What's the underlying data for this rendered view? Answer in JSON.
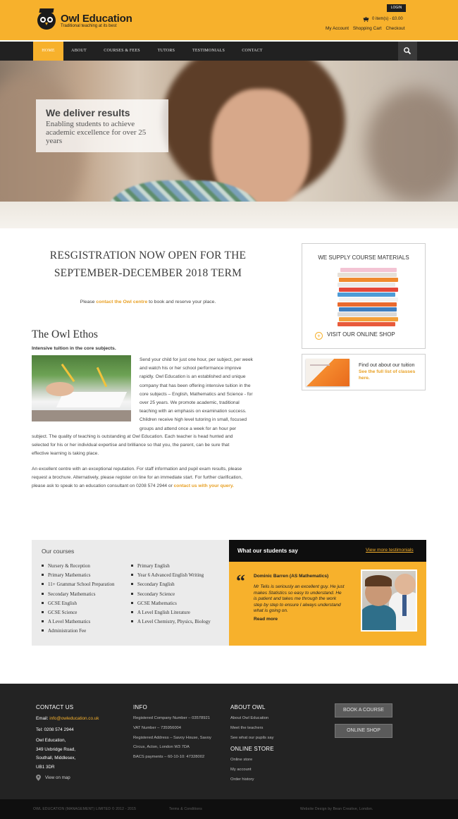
{
  "header": {
    "brand_name": "Owl Education",
    "brand_tagline": "Traditional teaching at its best",
    "login_label": "LOGIN",
    "cart_summary": "0 item(s) - £0.00",
    "account_links": [
      "My Account",
      "Shopping Cart",
      "Checkout"
    ],
    "colors": {
      "accent": "#f7b12c",
      "nav_bg": "#212121"
    }
  },
  "nav": {
    "items": [
      "HOME",
      "ABOUT",
      "COURSES & FEES",
      "TUTORS",
      "TESTIMONIALS",
      "CONTACT"
    ],
    "active": "HOME",
    "search_icon": "search-icon"
  },
  "hero": {
    "title": "We deliver results",
    "subtitle": "Enabling students to achieve academic excellence for over 25 years"
  },
  "registration": {
    "title_line1": "RESGISTRATION NOW OPEN FOR THE",
    "title_line2": "SEPTEMBER-DECEMBER 2018 TERM",
    "note_before": "Please ",
    "note_link": "contact the Owl centre",
    "note_after": " to book and reserve your place."
  },
  "ethos": {
    "title": "The Owl Ethos",
    "subtitle": "Intensive tuition in the core subjects.",
    "para1_lines": [
      "Send your child for just one hour, per subject, per week",
      "and watch his or her school performance improve",
      "rapidly. Owl Education is an established and unique",
      "company that has been offering intensive tuition in the",
      "core subjects – English, Mathematics and Science - for",
      "over 25 years. We promote academic, traditional",
      "teaching with an emphasis on examination success.",
      "Children receive high level tutoring in small, focused",
      "groups and attend once a week for an hour per"
    ],
    "para1_tail_lines": [
      "subject. The quality of teaching is outstanding at Owl Education. Each teacher is head hunted and",
      "selected for his or her individual expertise and brilliance so that you, the parent, can be sure that",
      "effective learning is taking place."
    ],
    "para2_lines": [
      "An excellent centre with an exceptional reputation. For staff information and pupil exam results, please",
      "request a brochure. Alternatively, please register on line for an immediate start. For further clarification,"
    ],
    "para2_last": "please ask to speak to an education consultant on 0208 574 2944 or ",
    "para2_link": "contact us with your query."
  },
  "sidebar": {
    "supply_title": "WE SUPPLY COURSE MATERIALS",
    "visit_label": "VISIT OUR ONLINE SHOP",
    "tuition_title": "Find out about our tuition",
    "tuition_link": "See the full list of classes here."
  },
  "courses": {
    "title": "Our courses",
    "column1": [
      "Nursery & Reception",
      "Primary Mathematics",
      "11+ Grammar School Preparation",
      "Secondary Mathematics",
      "GCSE English",
      "GCSE Science",
      "A Level Mathematics",
      "Administration Fee"
    ],
    "column2": [
      "Primary English",
      "Year 6 Advanced English Writing",
      "Secondary English",
      "Secondary Science",
      "GCSE Mathematics",
      "A Level English Literature",
      "A Level Chemistry, Physics, Biology"
    ]
  },
  "testimonials": {
    "title": "What our students say",
    "more_link": "View more testimonials",
    "quote_mark": "“",
    "name": "Dominic Barren (AS Mathematics)",
    "text": "Mr Telis is seriously an excellent guy. He just makes Statistics so easy to understand. He is patient and takes me through the work step by step to ensure I always understand what is going on.",
    "read_more": "Read more"
  },
  "footer": {
    "contact": {
      "title": "CONTACT US",
      "email_label": "Email: ",
      "email": "info@owleducation.co.uk",
      "tel": "Tel: 0208 574 2944",
      "address": [
        "Owl Education,",
        "349 Uxbridge Road,",
        "Southall, Middlesex,",
        "UB1 3DR"
      ],
      "map_link": "View on map"
    },
    "info": {
      "title": "INFO",
      "lines": [
        "Registered Company Number – 03578921",
        "VAT Number – 735956004",
        "Registered Address – Savoy House, Savoy",
        "Circus, Acton, London W3 7DA",
        "BACS payments – 60-10-10: 47328002"
      ]
    },
    "about": {
      "title": "ABOUT OWL",
      "links": [
        "About Owl Education",
        "Meet the teachers",
        "See what our pupils say"
      ]
    },
    "store": {
      "title": "ONLINE STORE",
      "links": [
        "Online store",
        "My account",
        "Order history"
      ]
    },
    "buttons": [
      "BOOK A COURSE",
      "ONLINE SHOP"
    ]
  },
  "bottom": {
    "copyright": "OWL EDUCATION (MANAGEMENT) LIMITED © 2012 - 2015",
    "terms": "Terms & Conditions",
    "credit": "Website Design by Bean Creative, London."
  }
}
